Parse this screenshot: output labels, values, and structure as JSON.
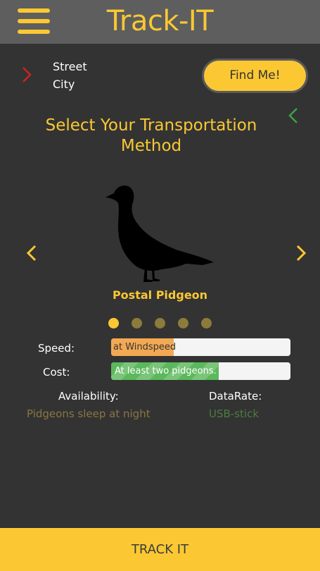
{
  "header": {
    "title": "Track-IT",
    "menu_icon": "hamburger-menu-icon",
    "bg_color": "#5e5e5e",
    "accent_color": "#fbc833"
  },
  "location": {
    "street": "Street",
    "city": "City",
    "status_icon": "chevron-right-icon",
    "status_color": "#cc2222",
    "find_me_label": "Find Me!"
  },
  "back": {
    "icon": "chevron-left-icon",
    "color": "#3aa34a"
  },
  "transport": {
    "title": "Select Your Transportation Method",
    "method_name": "Postal Pidgeon",
    "image_icon": "pigeon-silhouette-icon",
    "prev_icon": "chevron-left-icon",
    "next_icon": "chevron-right-icon",
    "pages_total": 5,
    "current_page": 1
  },
  "stats": {
    "speed": {
      "label": "Speed:",
      "text": "at Windspeed",
      "fill_fraction": 0.35,
      "color": "#f3a953"
    },
    "cost": {
      "label": "Cost:",
      "text": "At least two pidgeons.",
      "fill_fraction": 0.6,
      "color": "#5cb85c"
    }
  },
  "info": {
    "availability_label": "Availability:",
    "availability_value": "Pidgeons sleep at night",
    "datarate_label": "DataRate:",
    "datarate_value": "USB-stick"
  },
  "footer": {
    "track_label": "TRACK IT"
  }
}
